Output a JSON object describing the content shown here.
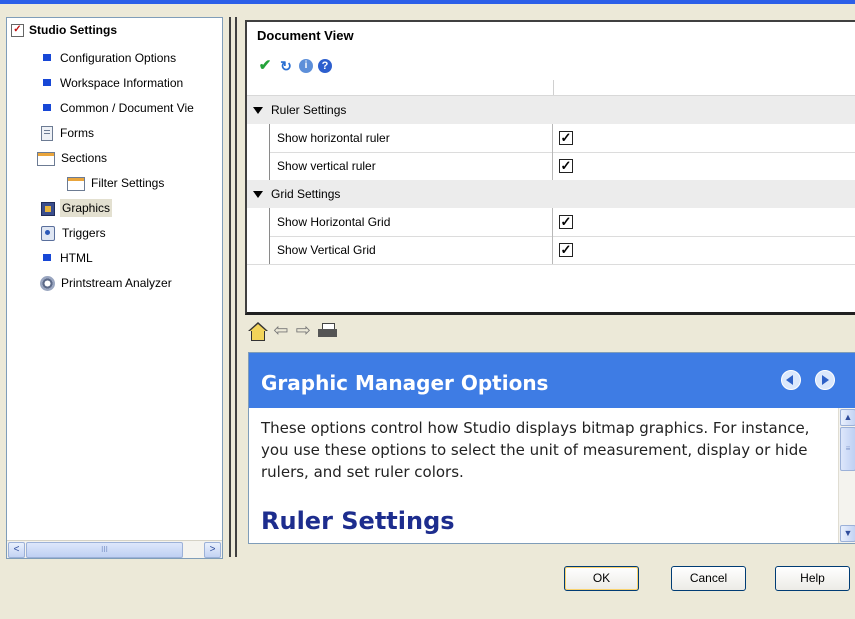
{
  "tree": {
    "root": "Studio Settings",
    "items": [
      {
        "label": "Configuration Options",
        "icon": "bullet-icon"
      },
      {
        "label": "Workspace Information",
        "icon": "bullet-icon"
      },
      {
        "label": "Common / Document Vie",
        "icon": "bullet-icon"
      },
      {
        "label": "Forms",
        "icon": "form-icon"
      },
      {
        "label": "Sections",
        "icon": "sections-icon"
      },
      {
        "label": "Filter Settings",
        "icon": "filter-icon"
      },
      {
        "label": "Graphics",
        "icon": "graphics-icon",
        "selected": true
      },
      {
        "label": "Triggers",
        "icon": "triggers-icon"
      },
      {
        "label": "HTML",
        "icon": "bullet-icon"
      },
      {
        "label": "Printstream Analyzer",
        "icon": "gear-icon"
      }
    ],
    "scroll_left": "<",
    "scroll_right": ">",
    "scroll_grip": "III"
  },
  "document_view": {
    "title": "Document View",
    "categories": [
      {
        "label": "Ruler Settings",
        "props": [
          {
            "label": "Show horizontal ruler",
            "checked": true
          },
          {
            "label": "Show vertical ruler",
            "checked": true
          }
        ]
      },
      {
        "label": "Grid Settings",
        "props": [
          {
            "label": "Show Horizontal Grid",
            "checked": true
          },
          {
            "label": "Show Vertical Grid",
            "checked": true
          }
        ]
      }
    ],
    "check_glyph": "✓"
  },
  "nav": {
    "back_arrow": "⇦",
    "forward_arrow": "⇨"
  },
  "help": {
    "title": "Graphic Manager Options",
    "body": "These options control how Studio displays bitmap graphics. For instance, you use these options to select the unit of measurement, display or hide rulers, and set ruler colors.",
    "heading": "Ruler Settings",
    "scroll_up": "▲",
    "scroll_down": "▼",
    "scroll_grip": "≡"
  },
  "buttons": {
    "ok": "OK",
    "cancel": "Cancel",
    "help": "Help"
  },
  "colors": {
    "help_header": "#3e7ce4",
    "heading": "#1d2d8e",
    "check_green": "#24a33a"
  }
}
